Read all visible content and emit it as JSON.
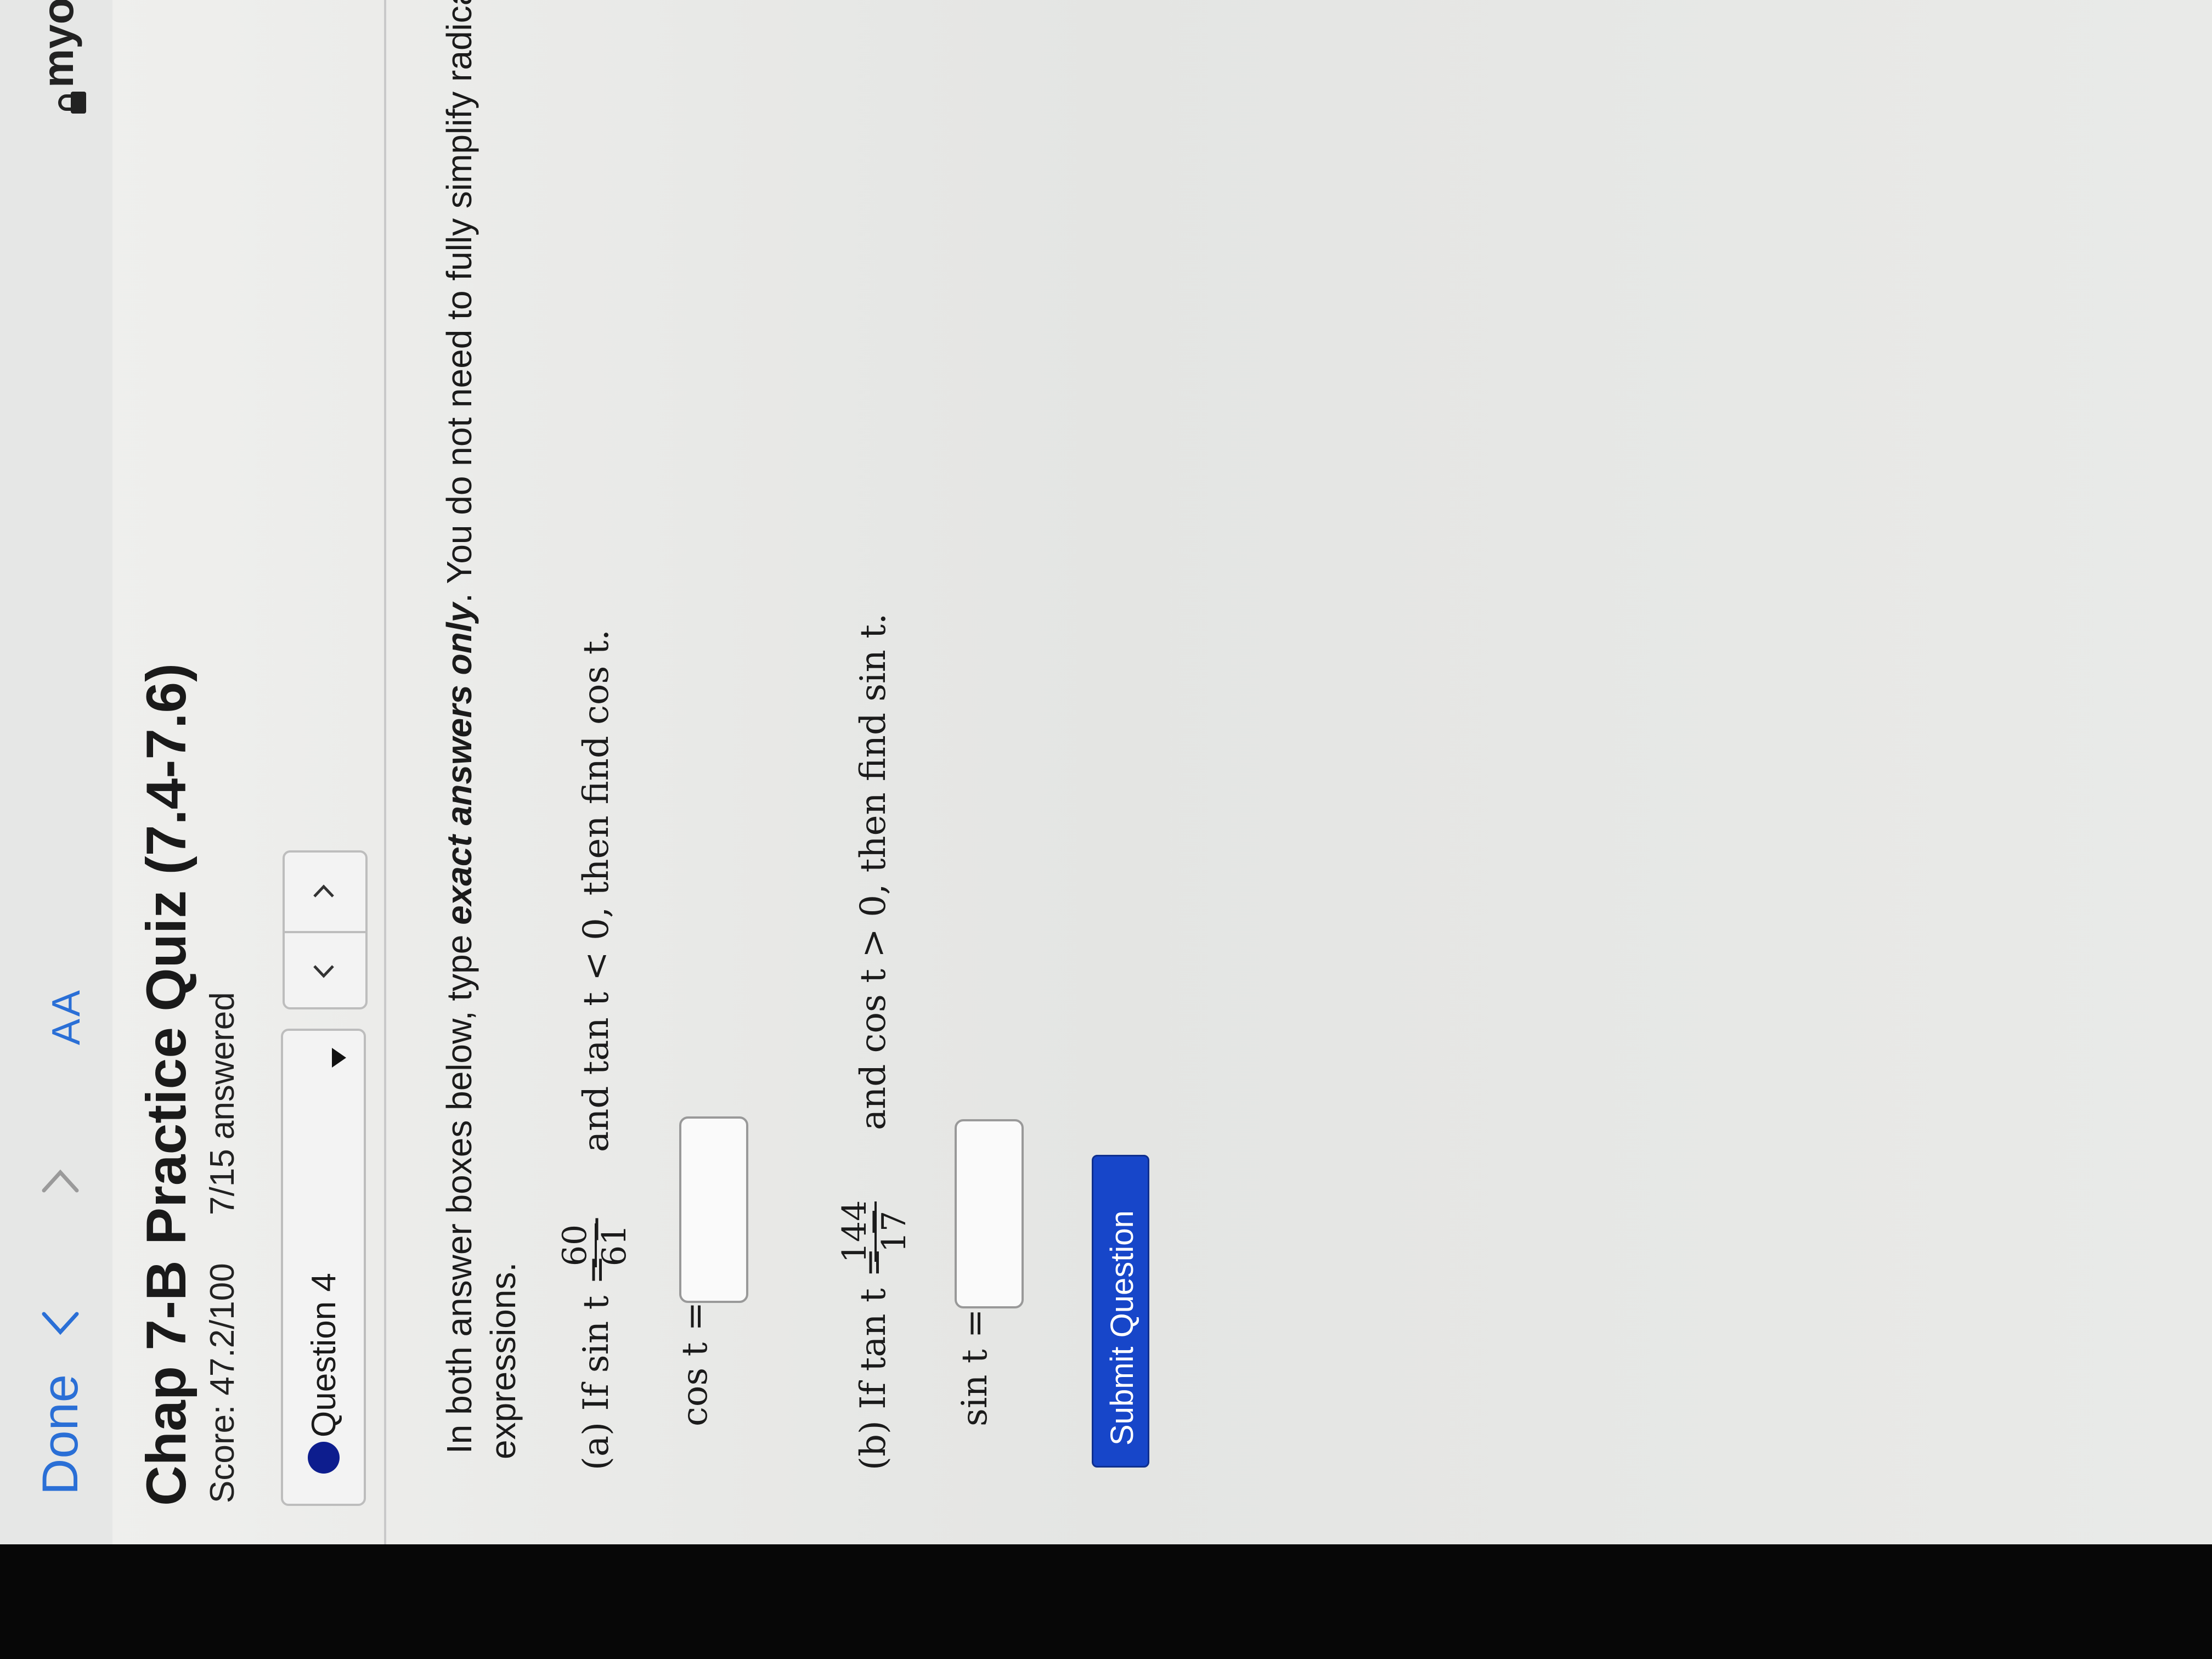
{
  "browser": {
    "done_label": "Done",
    "text_size_label": "AA",
    "site_label": "myo"
  },
  "quiz": {
    "title": "Chap 7-B Practice Quiz (7.4-7.6)",
    "score": "Score: 47.2/100",
    "answered": "7/15 answered",
    "question_label": "Question 4"
  },
  "problem": {
    "instruction_1_pre": "In both answer boxes below, type ",
    "instruction_1_em": "exact answers only",
    "instruction_1_post": ". You do not need to fully simplify radical",
    "instruction_2": "expressions.",
    "part_a_pre": "(a) If sin t = −",
    "part_a_num": "60",
    "part_a_den": "61",
    "part_a_post": "and tan t < 0, then find cos t.",
    "part_a_answer_label": "cos t =",
    "part_b_pre": "(b) If tan t = −",
    "part_b_num": "144",
    "part_b_den": "17",
    "part_b_post": "and cos t > 0, then find sin t.",
    "part_b_answer_label": "sin t ="
  },
  "submit_label": "Submit Question"
}
